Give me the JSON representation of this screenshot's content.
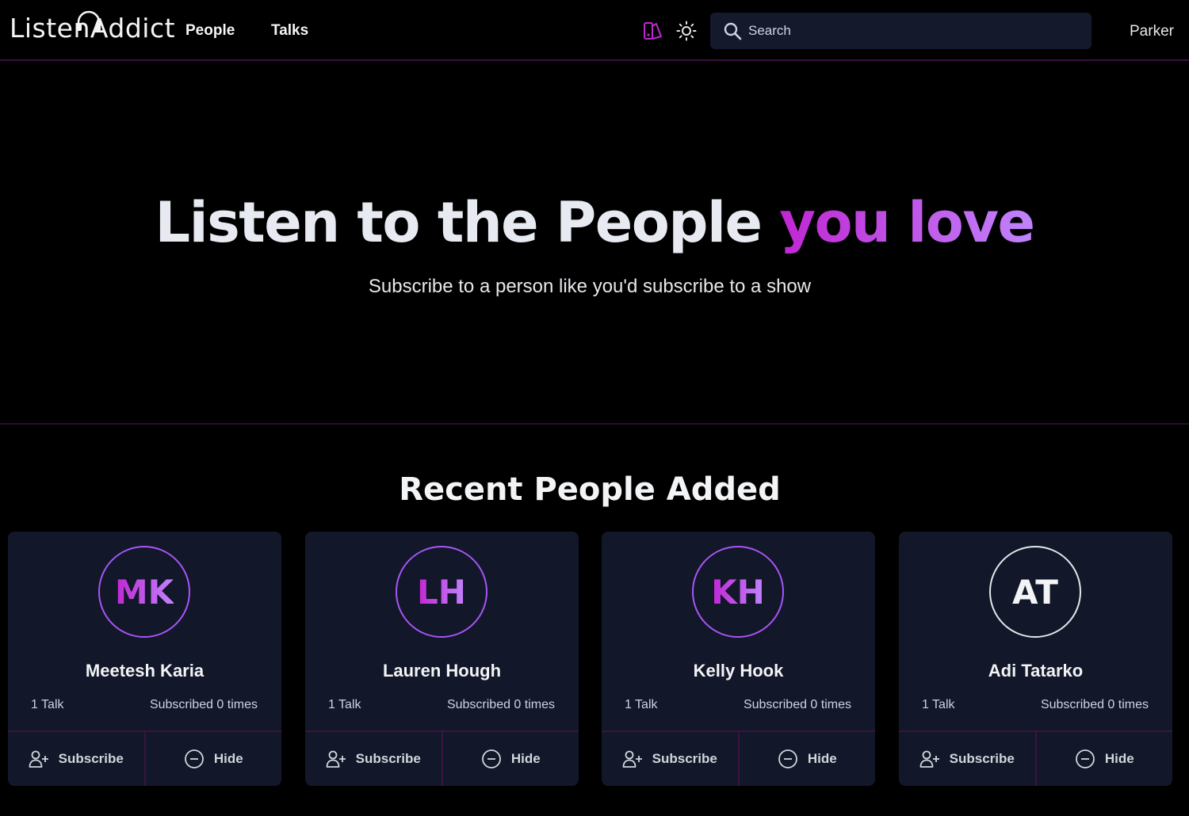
{
  "nav": {
    "logo_text": "ListenAddict",
    "links": [
      "People",
      "Talks"
    ],
    "search_placeholder": "Search",
    "user": "Parker",
    "accent_color": "#c026d3"
  },
  "hero": {
    "title_main": "Listen to the People ",
    "title_accent": "you love",
    "subtitle": "Subscribe to a person like you'd subscribe to a show"
  },
  "section": {
    "title": "Recent People Added"
  },
  "people": [
    {
      "initials": "MK",
      "name": "Meetesh Karia",
      "talks": "1 Talk",
      "subscribed": "Subscribed 0 times",
      "subscribe_label": "Subscribe",
      "hide_label": "Hide"
    },
    {
      "initials": "LH",
      "name": "Lauren Hough",
      "talks": "1 Talk",
      "subscribed": "Subscribed 0 times",
      "subscribe_label": "Subscribe",
      "hide_label": "Hide"
    },
    {
      "initials": "KH",
      "name": "Kelly Hook",
      "talks": "1 Talk",
      "subscribed": "Subscribed 0 times",
      "subscribe_label": "Subscribe",
      "hide_label": "Hide"
    },
    {
      "initials": "AT",
      "name": "Adi Tatarko",
      "talks": "1 Talk",
      "subscribed": "Subscribed 0 times",
      "subscribe_label": "Subscribe",
      "hide_label": "Hide"
    }
  ]
}
